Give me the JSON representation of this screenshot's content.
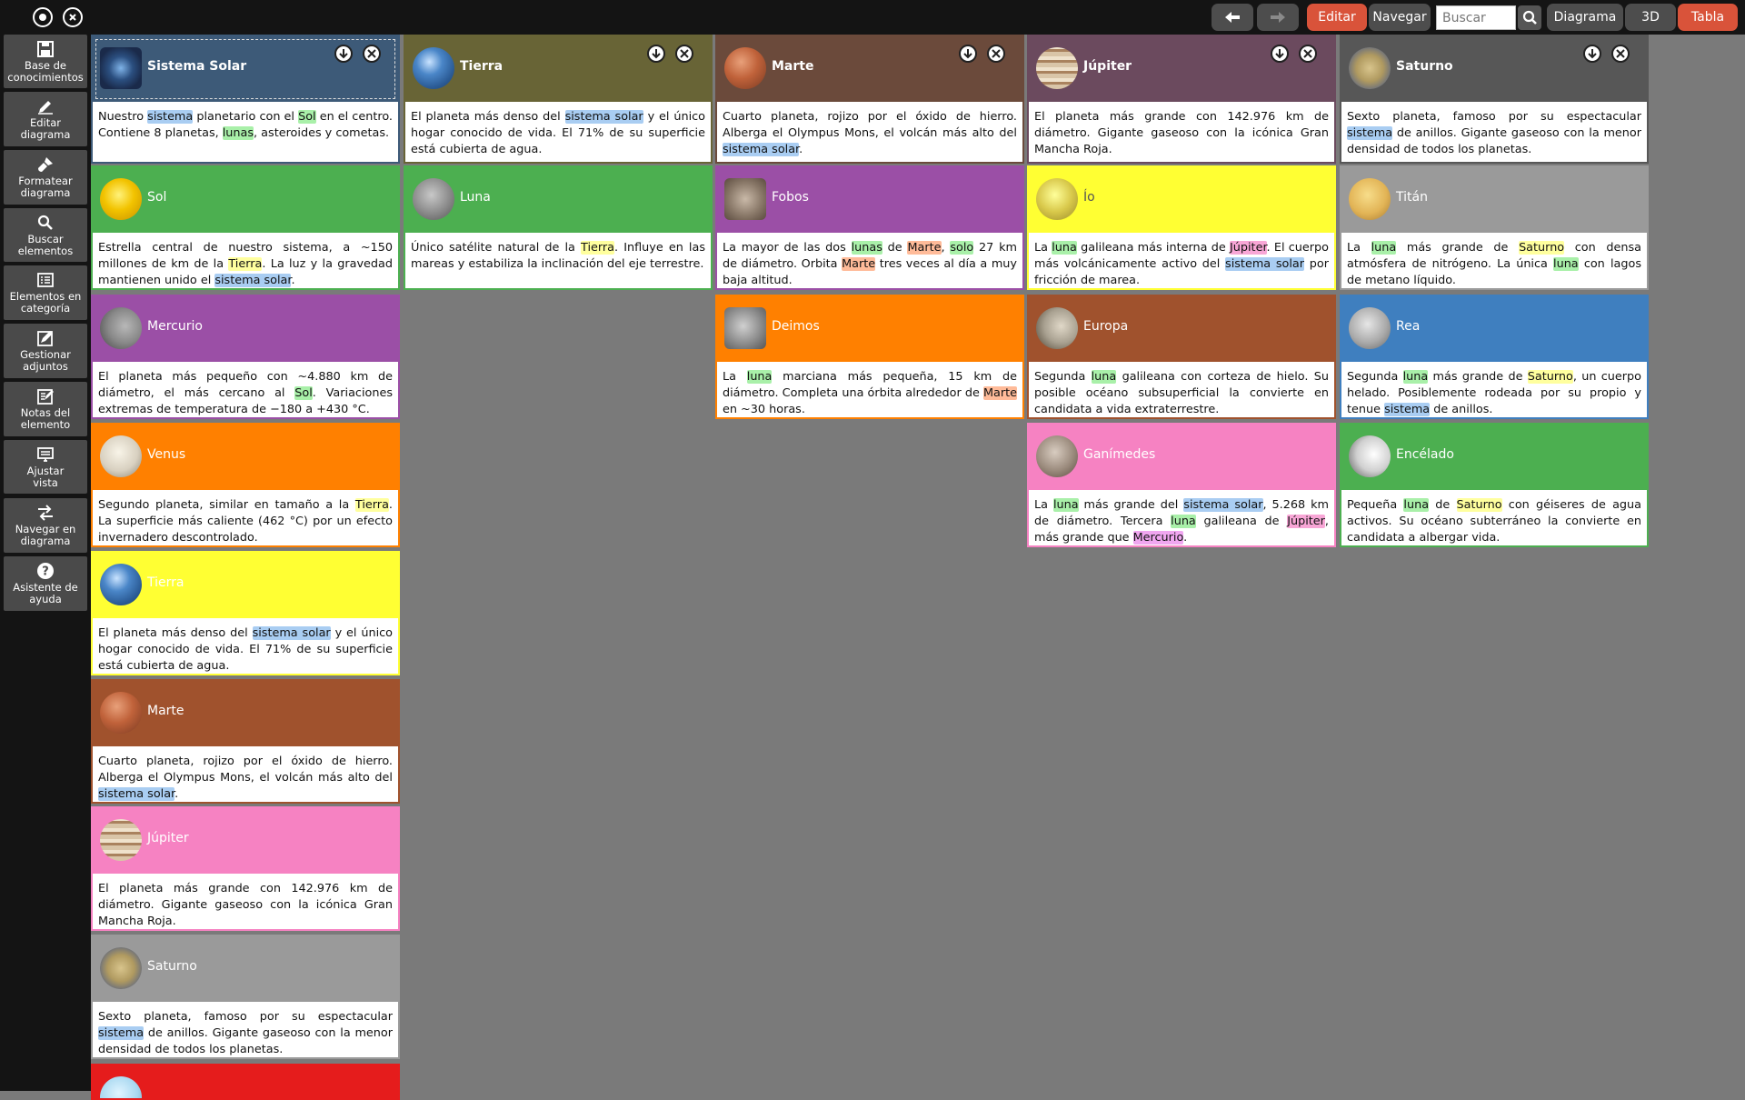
{
  "topbar": {
    "edit_label": "Editar",
    "navigate_label": "Navegar",
    "search_placeholder": "Buscar",
    "diagram_label": "Diagrama",
    "view3d_label": "3D",
    "table_label": "Tabla"
  },
  "sidebar": {
    "items": [
      {
        "name": "base-de-conocimientos",
        "icon": "save-icon",
        "line1": "Base de",
        "line2": "conocimientos"
      },
      {
        "name": "editar-diagrama",
        "icon": "pencil-icon",
        "line1": "Editar",
        "line2": "diagrama"
      },
      {
        "name": "formatear-diagrama",
        "icon": "brush-icon",
        "line1": "Formatear",
        "line2": "diagrama"
      },
      {
        "name": "buscar-elementos",
        "icon": "search-icon",
        "line1": "Buscar",
        "line2": "elementos"
      },
      {
        "name": "elementos-en-categoria",
        "icon": "list-icon",
        "line1": "Elementos en",
        "line2": "categoría"
      },
      {
        "name": "gestionar-adjuntos",
        "icon": "attachment-edit-icon",
        "line1": "Gestionar",
        "line2": "adjuntos"
      },
      {
        "name": "notas-del-elemento",
        "icon": "notes-icon",
        "line1": "Notas del",
        "line2": "elemento"
      },
      {
        "name": "ajustar-vista",
        "icon": "monitor-icon",
        "line1": "Ajustar",
        "line2": "vista"
      },
      {
        "name": "navegar-en-diagrama",
        "icon": "swap-arrows-icon",
        "line1": "Navegar en",
        "line2": "diagrama"
      },
      {
        "name": "asistente-de-ayuda",
        "icon": "help-icon",
        "line1": "Asistente de",
        "line2": "ayuda"
      }
    ]
  },
  "colors": {
    "blue": "#3d5a78",
    "olive": "#686436",
    "brown_dark": "#6b4a3b",
    "plum": "#6b4a5e",
    "graphite": "#575757",
    "green": "#4caf50",
    "purple": "#9b4fa6",
    "yellow": "#ffff33",
    "gray": "#9a9a9a",
    "orange": "#ff8000",
    "sienna": "#a0522d",
    "sky": "#3f7fbf",
    "pink": "#f682c2",
    "red": "#e51c1c",
    "hl_blue": "#a9cdf2",
    "hl_green": "#a9f0a9",
    "hl_yellow": "#ffff9e",
    "hl_salmon": "#ffbb99",
    "hl_pink": "#f8a6d6"
  },
  "cards": [
    {
      "id": "sistema-solar-top",
      "title": "Sistema Solar",
      "bold": true,
      "dark": false,
      "color": "#3d5a78",
      "border": "#3d5a78",
      "selected": true,
      "controls": true,
      "thumb": "galaxy",
      "segs": [
        [
          "Nuestro ",
          ""
        ],
        [
          "sistema",
          "#a9cdf2"
        ],
        [
          " planetario con el ",
          ""
        ],
        [
          "Sol",
          "#a9f0a9"
        ],
        [
          " en el centro. Contiene 8 planetas, ",
          ""
        ],
        [
          "lunas",
          "#a9f0a9"
        ],
        [
          ", asteroides y cometas.",
          ""
        ]
      ]
    },
    {
      "id": "tierra-top",
      "title": "Tierra",
      "bold": true,
      "dark": false,
      "color": "#686436",
      "border": "#686436",
      "selected": false,
      "controls": true,
      "thumb": "earth",
      "segs": [
        [
          "El planeta más denso del ",
          ""
        ],
        [
          "sistema solar",
          "#a9cdf2"
        ],
        [
          " y el único hogar conocido de vida. El 71% de su superficie está cubierta de agua.",
          ""
        ]
      ]
    },
    {
      "id": "marte-top",
      "title": "Marte",
      "bold": true,
      "dark": false,
      "color": "#6b4a3b",
      "border": "#6b4a3b",
      "selected": false,
      "controls": true,
      "thumb": "mars",
      "segs": [
        [
          "Cuarto planeta, rojizo por el óxido de hierro. Alberga el Olympus Mons, el volcán más alto del ",
          ""
        ],
        [
          "sistema solar",
          "#a9cdf2"
        ],
        [
          ".",
          ""
        ]
      ]
    },
    {
      "id": "jupiter-top",
      "title": "Júpiter",
      "bold": true,
      "dark": false,
      "color": "#6b4a5e",
      "border": "#6b4a5e",
      "selected": false,
      "controls": true,
      "thumb": "jupiter",
      "segs": [
        [
          "El planeta más grande con 142.976 km de diámetro. Gigante gaseoso con la icónica Gran Mancha Roja.",
          ""
        ]
      ]
    },
    {
      "id": "saturno-top",
      "title": "Saturno",
      "bold": true,
      "dark": false,
      "color": "#575757",
      "border": "#575757",
      "selected": false,
      "controls": true,
      "thumb": "saturn",
      "segs": [
        [
          "Sexto planeta, famoso por su espectacular ",
          ""
        ],
        [
          "sistema",
          "#a9cdf2"
        ],
        [
          " de anillos. Gigante gaseoso con la menor densidad de todos los planetas.",
          ""
        ]
      ]
    },
    {
      "id": "sol",
      "title": "Sol",
      "bold": false,
      "dark": false,
      "color": "#4caf50",
      "border": "#4caf50",
      "thumb": "sun",
      "segs": [
        [
          "Estrella central de nuestro sistema, a ~150 millones de km de la ",
          ""
        ],
        [
          "Tierra",
          "#ffff9e"
        ],
        [
          ". La luz y la gravedad mantienen unido el ",
          ""
        ],
        [
          "sistema solar",
          "#a9cdf2"
        ],
        [
          ".",
          ""
        ]
      ]
    },
    {
      "id": "luna",
      "title": "Luna",
      "bold": false,
      "dark": false,
      "color": "#4caf50",
      "border": "#4caf50",
      "thumb": "moon",
      "segs": [
        [
          "Único satélite natural de la ",
          ""
        ],
        [
          "Tierra",
          "#ffff9e"
        ],
        [
          ". Influye en las mareas y estabiliza la inclinación del eje terrestre.",
          ""
        ]
      ]
    },
    {
      "id": "fobos",
      "title": "Fobos",
      "bold": false,
      "dark": false,
      "color": "#9b4fa6",
      "border": "#9b4fa6",
      "thumb": "rock",
      "segs": [
        [
          "La mayor de las dos ",
          ""
        ],
        [
          "lunas",
          "#a9f0a9"
        ],
        [
          " de ",
          ""
        ],
        [
          "Marte",
          "#ffbb99"
        ],
        [
          ", ",
          ""
        ],
        [
          "solo",
          "#a9f0a9"
        ],
        [
          " 27 km de diámetro. Orbita ",
          ""
        ],
        [
          "Marte",
          "#ffbb99"
        ],
        [
          " tres veces al día a muy baja altitud.",
          ""
        ]
      ]
    },
    {
      "id": "io",
      "title": "Ío",
      "bold": false,
      "dark": true,
      "color": "#ffff33",
      "border": "#ffff33",
      "thumb": "io",
      "segs": [
        [
          "La ",
          ""
        ],
        [
          "luna",
          "#a9f0a9"
        ],
        [
          " galileana más interna de ",
          ""
        ],
        [
          "Júpiter",
          "#f8a6d6"
        ],
        [
          ". El cuerpo más volcánicamente activo del ",
          ""
        ],
        [
          "sistema solar",
          "#a9cdf2"
        ],
        [
          " por fricción de marea.",
          ""
        ]
      ]
    },
    {
      "id": "titan",
      "title": "Titán",
      "bold": false,
      "dark": false,
      "color": "#9a9a9a",
      "border": "#9a9a9a",
      "thumb": "titan",
      "segs": [
        [
          "La ",
          ""
        ],
        [
          "luna",
          "#a9f0a9"
        ],
        [
          " más grande de ",
          ""
        ],
        [
          "Saturno",
          "#ffff9e"
        ],
        [
          " con densa atmósfera de nitrógeno. La única ",
          ""
        ],
        [
          "luna",
          "#a9f0a9"
        ],
        [
          " con lagos de metano líquido.",
          ""
        ]
      ]
    },
    {
      "id": "mercurio",
      "title": "Mercurio",
      "bold": false,
      "dark": false,
      "color": "#9b4fa6",
      "border": "#9b4fa6",
      "thumb": "mercury",
      "segs": [
        [
          "El planeta más pequeño con ~4.880 km de diámetro, el más cercano al ",
          ""
        ],
        [
          "Sol",
          "#a9f0a9"
        ],
        [
          ". Variaciones extremas de temperatura de −180 a +430 °C.",
          ""
        ]
      ]
    },
    {
      "id": "deimos",
      "title": "Deimos",
      "bold": false,
      "dark": false,
      "color": "#ff8000",
      "border": "#ff8000",
      "thumb": "deimos",
      "segs": [
        [
          "La ",
          ""
        ],
        [
          "luna",
          "#a9f0a9"
        ],
        [
          " marciana más pequeña, 15 km de diámetro. Completa una órbita alrededor de ",
          ""
        ],
        [
          "Marte",
          "#ffbb99"
        ],
        [
          " en ~30 horas.",
          ""
        ]
      ]
    },
    {
      "id": "europa",
      "title": "Europa",
      "bold": false,
      "dark": false,
      "color": "#a0522d",
      "border": "#a0522d",
      "thumb": "europa",
      "segs": [
        [
          "Segunda ",
          ""
        ],
        [
          "luna",
          "#a9f0a9"
        ],
        [
          " galileana con corteza de hielo. Su posible océano subsuperficial la convierte en candidata a vida extraterrestre.",
          ""
        ]
      ]
    },
    {
      "id": "rea",
      "title": "Rea",
      "bold": false,
      "dark": false,
      "color": "#3f7fbf",
      "border": "#3f7fbf",
      "thumb": "rhea",
      "segs": [
        [
          "Segunda ",
          ""
        ],
        [
          "luna",
          "#a9f0a9"
        ],
        [
          " más grande de ",
          ""
        ],
        [
          "Saturno",
          "#ffff9e"
        ],
        [
          ", un cuerpo helado. Posiblemente rodeada por su propio y tenue ",
          ""
        ],
        [
          "sistema",
          "#a9cdf2"
        ],
        [
          " de anillos.",
          ""
        ]
      ]
    },
    {
      "id": "venus",
      "title": "Venus",
      "bold": false,
      "dark": false,
      "color": "#ff8000",
      "border": "#ff8000",
      "thumb": "venus",
      "segs": [
        [
          "Segundo planeta, similar en tamaño a la ",
          ""
        ],
        [
          "Tierra",
          "#ffff9e"
        ],
        [
          ". La superficie más caliente (462 °C) por un efecto invernadero descontrolado.",
          ""
        ]
      ]
    },
    {
      "id": "ganimedes",
      "title": "Ganímedes",
      "bold": false,
      "dark": false,
      "color": "#f682c2",
      "border": "#f682c2",
      "thumb": "ganymede",
      "segs": [
        [
          "La ",
          ""
        ],
        [
          "luna",
          "#a9f0a9"
        ],
        [
          " más grande del ",
          ""
        ],
        [
          "sistema solar",
          "#a9cdf2"
        ],
        [
          ", 5.268 km de diámetro. Tercera ",
          ""
        ],
        [
          "luna",
          "#a9f0a9"
        ],
        [
          " galileana de ",
          ""
        ],
        [
          "Júpiter",
          "#f8a6d6"
        ],
        [
          ", más grande que ",
          ""
        ],
        [
          "Mercurio",
          "#f0a6f0"
        ],
        [
          ".",
          ""
        ]
      ]
    },
    {
      "id": "encelado",
      "title": "Encélado",
      "bold": false,
      "dark": false,
      "color": "#4caf50",
      "border": "#4caf50",
      "thumb": "enceladus",
      "segs": [
        [
          "Pequeña ",
          ""
        ],
        [
          "luna",
          "#a9f0a9"
        ],
        [
          " de ",
          ""
        ],
        [
          "Saturno",
          "#ffff9e"
        ],
        [
          " con géiseres de agua activos. Su océano subterráneo la convierte en candidata a albergar vida.",
          ""
        ]
      ]
    },
    {
      "id": "tierra-col",
      "title": "Tierra",
      "bold": false,
      "dark": false,
      "color": "#ffff33",
      "border": "#ffff33",
      "thumb": "earth",
      "segs": [
        [
          "El planeta más denso del ",
          ""
        ],
        [
          "sistema solar",
          "#a9cdf2"
        ],
        [
          " y el único hogar conocido de vida. El 71% de su superficie está cubierta de agua.",
          ""
        ]
      ]
    },
    {
      "id": "marte-col",
      "title": "Marte",
      "bold": false,
      "dark": false,
      "color": "#a0522d",
      "border": "#a0522d",
      "thumb": "mars",
      "segs": [
        [
          "Cuarto planeta, rojizo por el óxido de hierro. Alberga el Olympus Mons, el volcán más alto del ",
          ""
        ],
        [
          "sistema solar",
          "#a9cdf2"
        ],
        [
          ".",
          ""
        ]
      ]
    },
    {
      "id": "jupiter-col",
      "title": "Júpiter",
      "bold": false,
      "dark": false,
      "color": "#f682c2",
      "border": "#f682c2",
      "thumb": "jupiter",
      "segs": [
        [
          "El planeta más grande con 142.976 km de diámetro. Gigante gaseoso con la icónica Gran Mancha Roja.",
          ""
        ]
      ]
    },
    {
      "id": "saturno-col",
      "title": "Saturno",
      "bold": false,
      "dark": false,
      "color": "#9a9a9a",
      "border": "#9a9a9a",
      "thumb": "saturn",
      "segs": [
        [
          "Sexto planeta, famoso por su espectacular ",
          ""
        ],
        [
          "sistema",
          "#a9cdf2"
        ],
        [
          " de anillos. Gigante gaseoso con la menor densidad de todos los planetas.",
          ""
        ]
      ]
    },
    {
      "id": "urano-partial",
      "title": "",
      "bold": false,
      "dark": false,
      "color": "#e51c1c",
      "border": "#e51c1c",
      "thumb": "uranus",
      "segs": []
    }
  ]
}
